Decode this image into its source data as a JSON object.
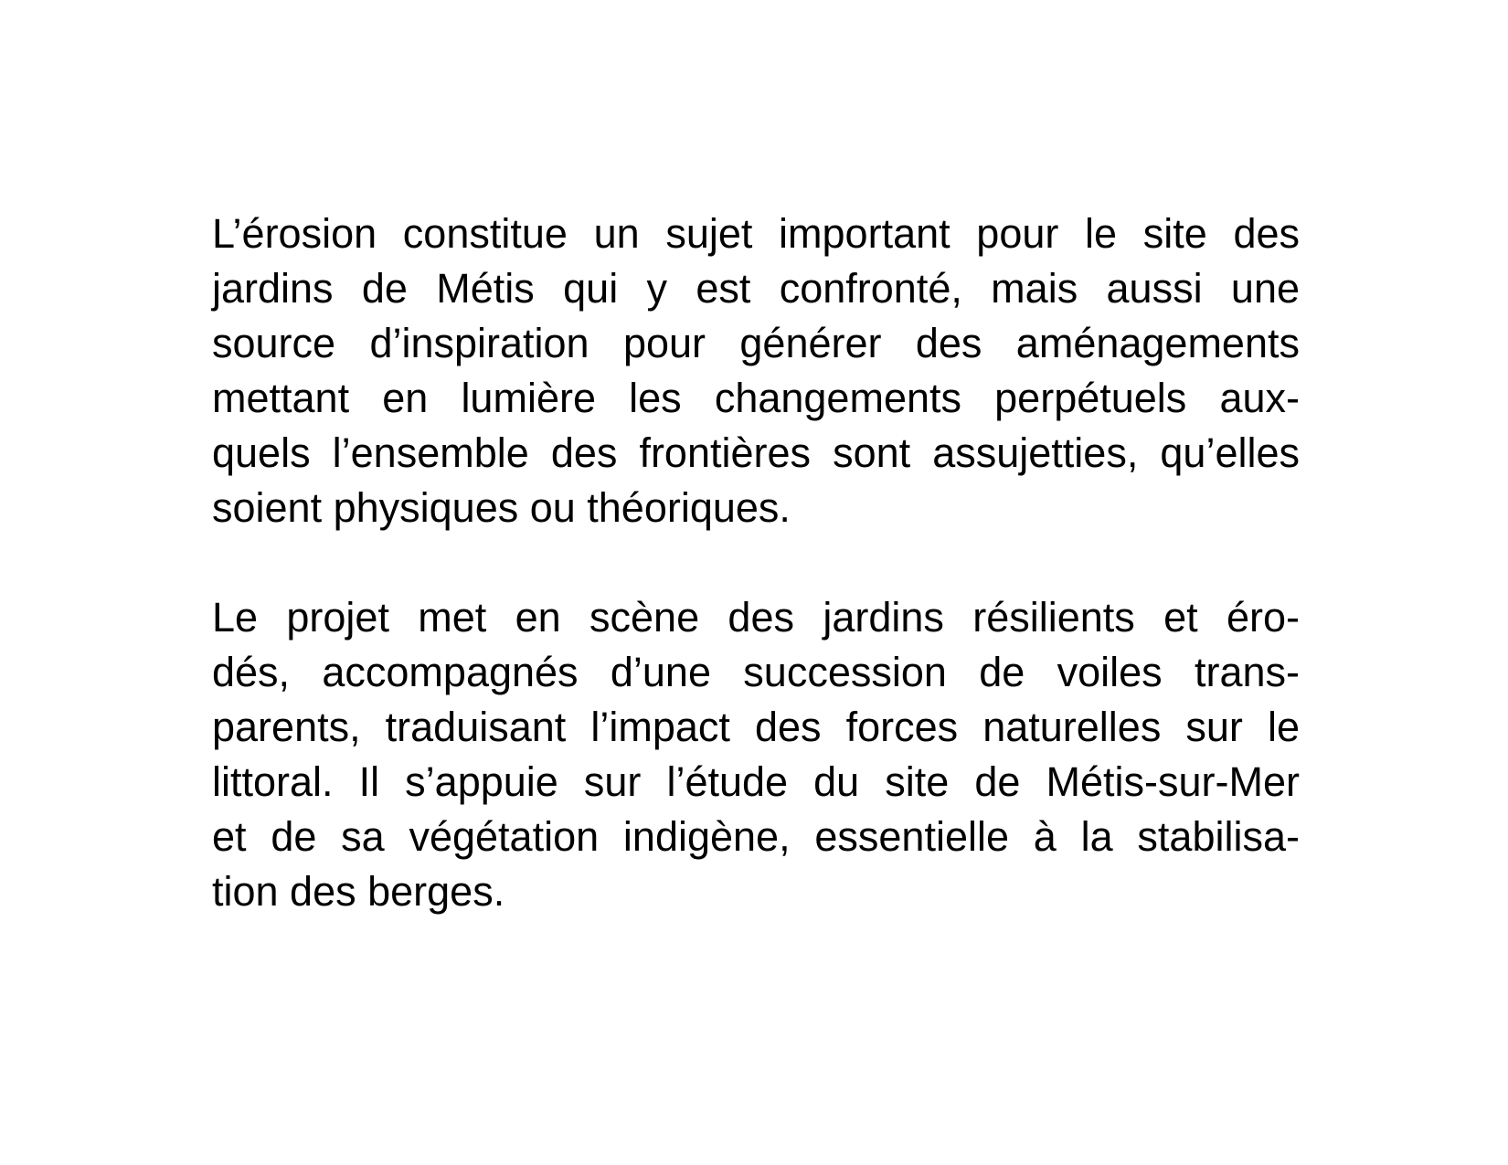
{
  "paragraphs": [
    {
      "lines": [
        "L’érosion constitue un sujet important pour le site des",
        "jardins de Métis qui y est confronté, mais aussi une",
        "source d’inspiration pour générer des aménagements",
        "mettant en lumière les changements perpétuels aux-",
        "quels l’ensemble des frontières sont assujetties, qu’elles",
        "soient physiques ou théoriques."
      ]
    },
    {
      "lines": [
        "Le projet met en scène des jardins résilients et éro-",
        "dés, accompagnés d’une succession de voiles trans-",
        "parents, traduisant l’impact des forces naturelles sur le",
        "littoral. Il s’appuie sur l’étude du site de Métis-sur-Mer",
        "et de sa végétation indigène, essentielle à la stabilisa-",
        "tion des berges."
      ]
    }
  ]
}
